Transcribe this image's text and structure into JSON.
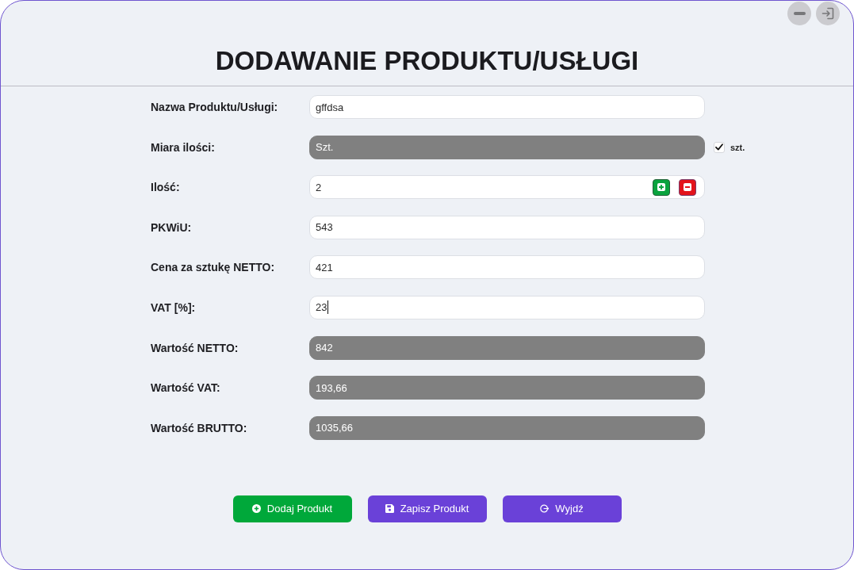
{
  "window": {
    "title": "DODAWANIE PRODUKTU/USŁUGI"
  },
  "form": {
    "rows": [
      {
        "kind": "text",
        "label": "Nazwa Produktu/Usługi:",
        "value": "gffdsa",
        "readonly": false,
        "focused": false
      },
      {
        "kind": "unit",
        "label": "Miara ilości:",
        "value": "Szt.",
        "readonly": true,
        "focused": false,
        "checkbox": {
          "label": "szt.",
          "checked": true
        }
      },
      {
        "kind": "stepper",
        "label": "Ilość:",
        "value": "2",
        "readonly": false,
        "focused": false
      },
      {
        "kind": "text",
        "label": "PKWiU:",
        "value": "543",
        "readonly": false,
        "focused": false
      },
      {
        "kind": "text",
        "label": "Cena za sztukę NETTO:",
        "value": "421",
        "readonly": false,
        "focused": false
      },
      {
        "kind": "text",
        "label": "VAT [%]:",
        "value": "23",
        "readonly": false,
        "focused": true
      },
      {
        "kind": "text",
        "label": "Wartość NETTO:",
        "value": "842",
        "readonly": true,
        "focused": false
      },
      {
        "kind": "text",
        "label": "Wartość VAT:",
        "value": "193,66",
        "readonly": true,
        "focused": false
      },
      {
        "kind": "text",
        "label": "Wartość BRUTTO:",
        "value": "1035,66",
        "readonly": true,
        "focused": false
      }
    ]
  },
  "buttons": [
    {
      "kind": "add",
      "label": "Dodaj Produkt"
    },
    {
      "kind": "save",
      "label": "Zapisz Produkt"
    },
    {
      "kind": "exit",
      "label": "Wyjdź"
    }
  ]
}
